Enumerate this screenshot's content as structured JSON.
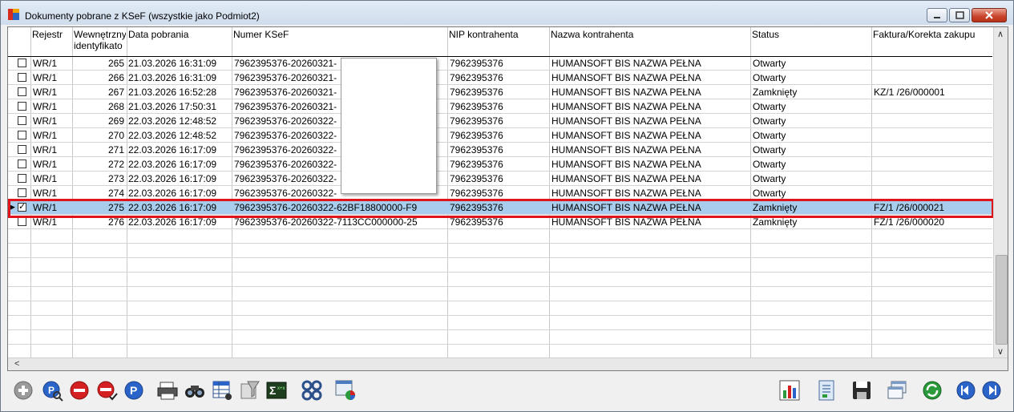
{
  "window": {
    "title": "Dokumenty pobrane z KSeF (wszystkie jako Podmiot2)"
  },
  "columns": {
    "rejestr": "Rejestr",
    "wewn1": "Wewnętrzny",
    "wewn2": "identyfikato",
    "data": "Data pobrania",
    "numer": "Numer KSeF",
    "nip": "NIP kontrahenta",
    "nazwa": "Nazwa kontrahenta",
    "status": "Status",
    "faktura": "Faktura/Korekta zakupu"
  },
  "rows": [
    {
      "rejestr": "WR/1",
      "id": "265",
      "data": "21.03.2026 16:31:09",
      "numer": "7962395376-20260321-",
      "nip": "7962395376",
      "nazwa": "HUMANSOFT BIS NAZWA PEŁNA",
      "status": "Otwarty",
      "faktura": "",
      "checked": false
    },
    {
      "rejestr": "WR/1",
      "id": "266",
      "data": "21.03.2026 16:31:09",
      "numer": "7962395376-20260321-",
      "nip": "7962395376",
      "nazwa": "HUMANSOFT BIS NAZWA PEŁNA",
      "status": "Otwarty",
      "faktura": "",
      "checked": false
    },
    {
      "rejestr": "WR/1",
      "id": "267",
      "data": "21.03.2026 16:52:28",
      "numer": "7962395376-20260321-",
      "nip": "7962395376",
      "nazwa": "HUMANSOFT BIS NAZWA PEŁNA",
      "status": "Zamknięty",
      "faktura": "KZ/1  /26/000001",
      "checked": false
    },
    {
      "rejestr": "WR/1",
      "id": "268",
      "data": "21.03.2026 17:50:31",
      "numer": "7962395376-20260321-",
      "nip": "7962395376",
      "nazwa": "HUMANSOFT BIS NAZWA PEŁNA",
      "status": "Otwarty",
      "faktura": "",
      "checked": false
    },
    {
      "rejestr": "WR/1",
      "id": "269",
      "data": "22.03.2026 12:48:52",
      "numer": "7962395376-20260322-",
      "nip": "7962395376",
      "nazwa": "HUMANSOFT BIS NAZWA PEŁNA",
      "status": "Otwarty",
      "faktura": "",
      "checked": false
    },
    {
      "rejestr": "WR/1",
      "id": "270",
      "data": "22.03.2026 12:48:52",
      "numer": "7962395376-20260322-",
      "nip": "7962395376",
      "nazwa": "HUMANSOFT BIS NAZWA PEŁNA",
      "status": "Otwarty",
      "faktura": "",
      "checked": false
    },
    {
      "rejestr": "WR/1",
      "id": "271",
      "data": "22.03.2026 16:17:09",
      "numer": "7962395376-20260322-",
      "nip": "7962395376",
      "nazwa": "HUMANSOFT BIS NAZWA PEŁNA",
      "status": "Otwarty",
      "faktura": "",
      "checked": false
    },
    {
      "rejestr": "WR/1",
      "id": "272",
      "data": "22.03.2026 16:17:09",
      "numer": "7962395376-20260322-",
      "nip": "7962395376",
      "nazwa": "HUMANSOFT BIS NAZWA PEŁNA",
      "status": "Otwarty",
      "faktura": "",
      "checked": false
    },
    {
      "rejestr": "WR/1",
      "id": "273",
      "data": "22.03.2026 16:17:09",
      "numer": "7962395376-20260322-",
      "nip": "7962395376",
      "nazwa": "HUMANSOFT BIS NAZWA PEŁNA",
      "status": "Otwarty",
      "faktura": "",
      "checked": false
    },
    {
      "rejestr": "WR/1",
      "id": "274",
      "data": "22.03.2026 16:17:09",
      "numer": "7962395376-20260322-",
      "nip": "7962395376",
      "nazwa": "HUMANSOFT BIS NAZWA PEŁNA",
      "status": "Otwarty",
      "faktura": "",
      "checked": false
    },
    {
      "rejestr": "WR/1",
      "id": "275",
      "data": "22.03.2026 16:17:09",
      "numer": "7962395376-20260322-62BF18800000-F9",
      "nip": "7962395376",
      "nazwa": "HUMANSOFT BIS NAZWA PEŁNA",
      "status": "Zamknięty",
      "faktura": "FZ/1  /26/000021",
      "checked": true
    },
    {
      "rejestr": "WR/1",
      "id": "276",
      "data": "22.03.2026 16:17:09",
      "numer": "7962395376-20260322-7113CC000000-25",
      "nip": "7962395376",
      "nazwa": "HUMANSOFT BIS NAZWA PEŁNA",
      "status": "Zamknięty",
      "faktura": "FZ/1  /26/000020",
      "checked": false
    }
  ],
  "selected_row": 10,
  "toolbar_left": [
    "add-icon",
    "search-edit-icon",
    "delete-icon",
    "delete-options-icon",
    "p-icon",
    "printer-icon",
    "binoculars-icon",
    "table-filter-icon",
    "filter-icon",
    "sum-icon",
    "modules-icon",
    "chart-window-icon"
  ],
  "toolbar_right": [
    "bar-chart-icon",
    "document-icon",
    "save-icon",
    "windows-icon",
    "refresh-icon",
    "nav-first-icon",
    "nav-last-icon"
  ],
  "colors": {
    "selection": "#a8cdec",
    "highlight": "#e0151b"
  }
}
